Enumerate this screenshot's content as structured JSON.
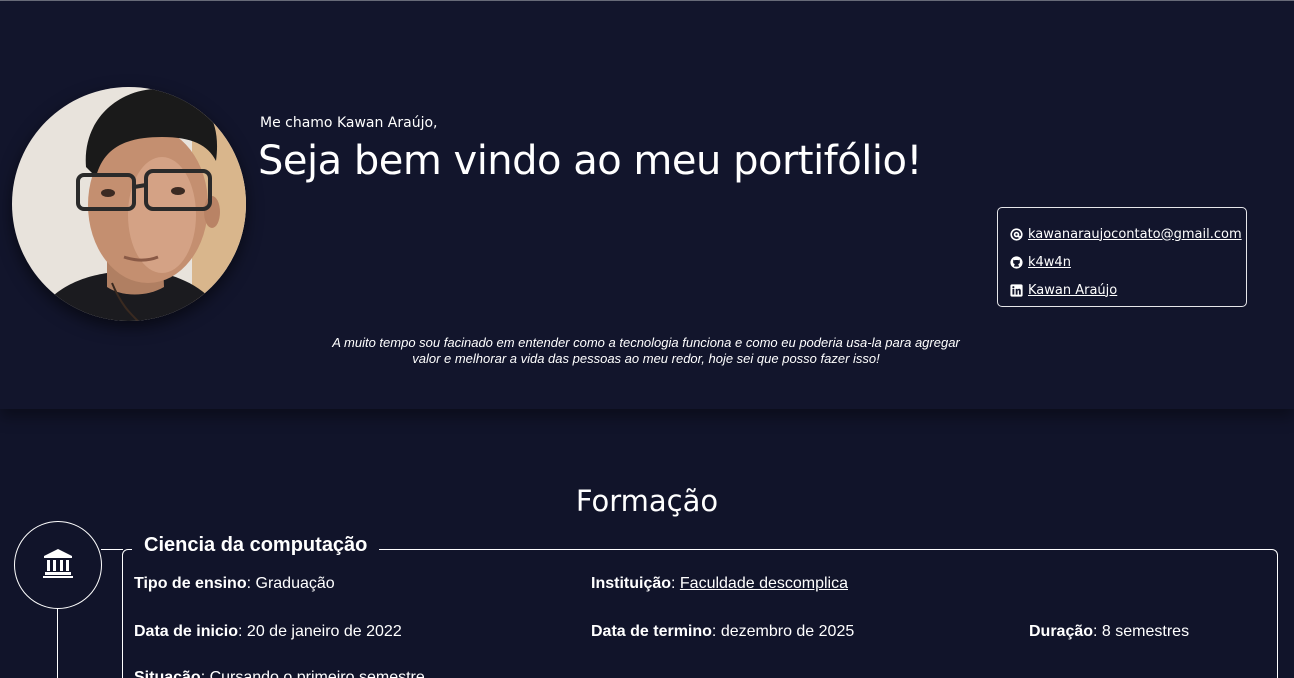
{
  "hero": {
    "greeting": "Me chamo Kawan Araújo,",
    "headline": "Seja bem vindo ao meu portifólio!",
    "bio": "A muito tempo sou facinado em entender como a tecnologia funciona e como eu poderia usa-la para agregar valor e melhorar a vida das pessoas ao meu redor, hoje sei que posso fazer isso!",
    "avatar_icon": "profile-photo"
  },
  "contacts": [
    {
      "icon": "at-icon",
      "label": "kawanaraujocontato@gmail.com"
    },
    {
      "icon": "github-icon",
      "label": "k4w4n"
    },
    {
      "icon": "linkedin-icon",
      "label": "Kawan Araújo"
    }
  ],
  "formacao": {
    "title": "Formação",
    "icon": "institution-icon",
    "course": {
      "title": "Ciencia da computação",
      "fields": {
        "tipo": {
          "label": "Tipo de ensino",
          "value": "Graduação"
        },
        "instituicao": {
          "label": "Instituição",
          "value": "Faculdade descomplica"
        },
        "inicio": {
          "label": "Data de inicio",
          "value": "20 de janeiro de 2022"
        },
        "termino": {
          "label": "Data de termino",
          "value": "dezembro de 2025"
        },
        "duracao": {
          "label": "Duração",
          "value": "8 semestres"
        },
        "situacao": {
          "label": "Situação",
          "value": "Cursando o primeiro semestre"
        }
      }
    }
  },
  "colors": {
    "background": "#11142a",
    "hero_background": "#12152c",
    "text": "#ffffff"
  }
}
